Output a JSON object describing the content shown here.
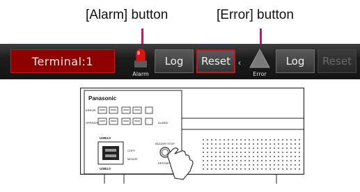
{
  "callouts": {
    "alarm": "[Alarm] button",
    "error": "[Error] button"
  },
  "toolbar": {
    "terminal_label": "Terminal:1",
    "alarm_icon": "alarm-lamp-icon",
    "alarm_label": "Alarm",
    "log_label_1": "Log",
    "reset_label_1": "Reset",
    "chevron": "‹",
    "error_icon": "warning-triangle-icon",
    "error_label": "Error",
    "log_label_2": "Log",
    "reset_label_2": "Reset"
  },
  "device": {
    "brand": "Panasonic",
    "error_label": "ERROR",
    "operate_label": "OPERATE",
    "alarm_label": "ALARM",
    "usb3_label": "USB3.0",
    "usb2_label": "USB2.0",
    "copy_label": "COPY",
    "mouse_label": "MOUSE",
    "buzzer_label": "BUZZER STOP",
    "restart_label": "RESTART"
  },
  "colors": {
    "leader": "#e6007e",
    "terminal_bg": "#8c0000",
    "reset_border": "#c8141b",
    "alarm_lamp": "#e01010"
  }
}
